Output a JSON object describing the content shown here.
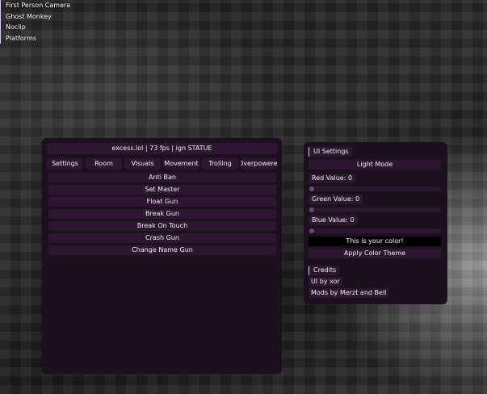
{
  "mod_list": [
    "First Person Camera",
    "Ghost Monkey",
    "Noclip",
    "Platforms"
  ],
  "main_window": {
    "title": "excess.lol | 73 fps | ign STATUE",
    "tabs": [
      "Settings",
      "Room",
      "Visuals",
      "Movement",
      "Trolling",
      "Overpowered"
    ],
    "buttons": [
      "Anti Ban",
      "Set Master",
      "Float Gun",
      "Break Gun",
      "Break On Touch",
      "Crash Gun",
      "Change Name Gun"
    ]
  },
  "settings_window": {
    "heading": "UI Settings",
    "mode_button": "Light Mode",
    "red_label": "Red Value: 0",
    "green_label": "Green Value: 0",
    "blue_label": "Blue Value: 0",
    "red_value": 0,
    "green_value": 0,
    "blue_value": 0,
    "preview_text": "This is your color!",
    "preview_color": "#000000",
    "apply_button": "Apply Color Theme",
    "credits_heading": "Credits",
    "credit_1": "UI by xor",
    "credit_2": "Mods by Merzt and Bell"
  },
  "colors": {
    "panel": "#1c0f1e",
    "button": "#2d1630",
    "accent": "#e2d4f4"
  }
}
